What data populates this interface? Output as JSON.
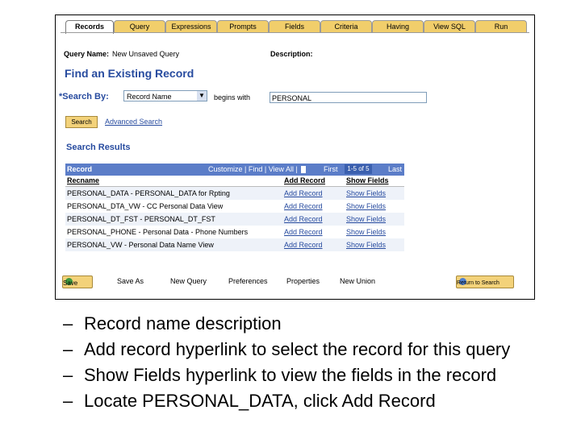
{
  "tabs": [
    "Records",
    "Query",
    "Expressions",
    "Prompts",
    "Fields",
    "Criteria",
    "Having",
    "View SQL",
    "Run"
  ],
  "query_name_label": "Query Name:",
  "query_name_value": "New Unsaved Query",
  "description_label": "Description:",
  "find_heading": "Find an Existing Record",
  "search_by_label": "*Search By:",
  "search_by_value": "Record Name",
  "begins_with_label": "begins with",
  "search_text": "PERSONAL",
  "search_button": "Search",
  "advanced_search": "Advanced Search",
  "results_heading": "Search Results",
  "grid": {
    "title": "Record",
    "customize": "Customize | Find | View All |",
    "nav": "First",
    "count": "1-5 of 5",
    "last": "Last",
    "columns": [
      "Recname",
      "Add Record",
      "Show Fields"
    ],
    "rows": [
      {
        "recname": "PERSONAL_DATA - PERSONAL_DATA for Rpting",
        "add": "Add Record",
        "show": "Show Fields"
      },
      {
        "recname": "PERSONAL_DTA_VW - CC Personal Data View",
        "add": "Add Record",
        "show": "Show Fields"
      },
      {
        "recname": "PERSONAL_DT_FST - PERSONAL_DT_FST",
        "add": "Add Record",
        "show": "Show Fields"
      },
      {
        "recname": "PERSONAL_PHONE - Personal Data - Phone Numbers",
        "add": "Add Record",
        "show": "Show Fields"
      },
      {
        "recname": "PERSONAL_VW - Personal Data Name View",
        "add": "Add Record",
        "show": "Show Fields"
      }
    ]
  },
  "bottom": {
    "save": "Save",
    "save_as": "Save As",
    "new_query": "New Query",
    "preferences": "Preferences",
    "properties": "Properties",
    "new_union": "New Union",
    "return": "Return to Search"
  },
  "bullets": [
    "Record name description",
    "Add record hyperlink to select the record for this query",
    "Show Fields hyperlink to view the fields in the record",
    "Locate PERSONAL_DATA, click Add Record"
  ],
  "bullet_marker": "–",
  "colors": {
    "tab": "#f1ce6b",
    "header": "#5b7dc8",
    "link": "#274b9f"
  }
}
